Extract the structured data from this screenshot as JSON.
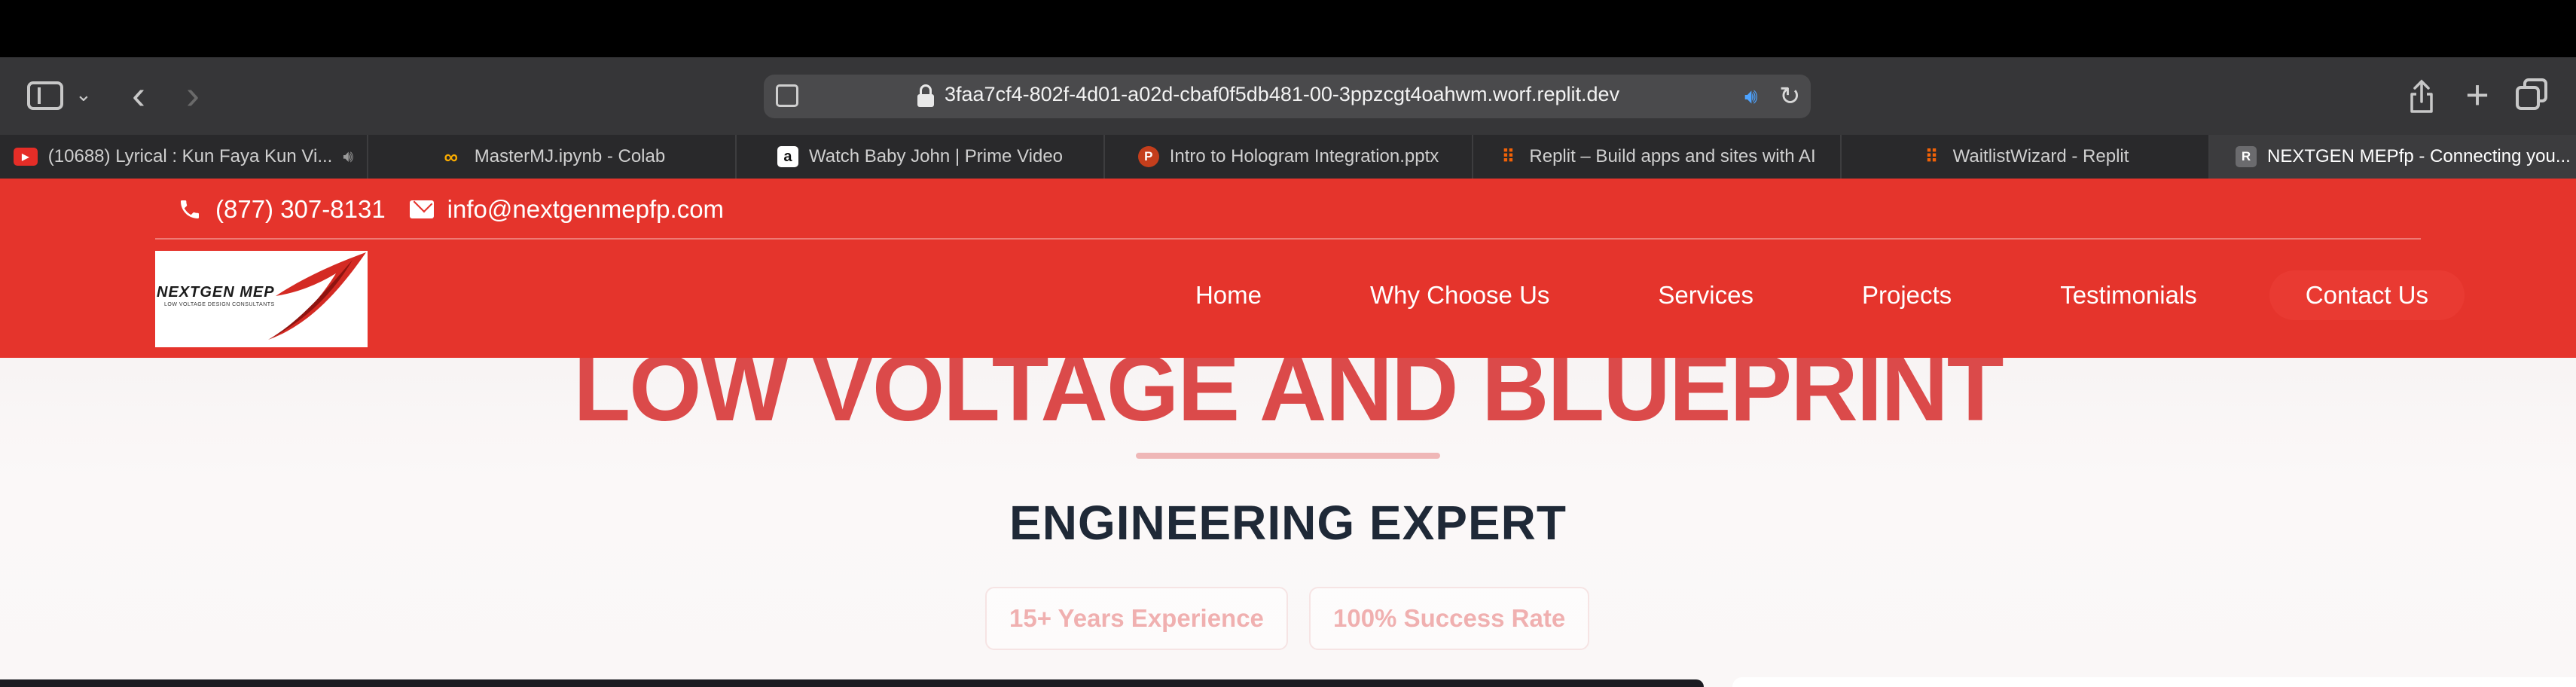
{
  "browser": {
    "url": "3faa7cf4-802f-4d01-a02d-cbaf0f5db481-00-3ppzcgt4oahwm.worf.replit.dev",
    "tabs": [
      {
        "title": "(10688) Lyrical : Kun Faya Kun Vi...",
        "favicon": "youtube-icon",
        "muted_icon": "speaker-icon"
      },
      {
        "title": "MasterMJ.ipynb - Colab",
        "favicon": "colab-icon"
      },
      {
        "title": "Watch Baby John | Prime Video",
        "favicon": "amazon-icon"
      },
      {
        "title": "Intro to Hologram Integration.pptx",
        "favicon": "powerpoint-icon"
      },
      {
        "title": "Replit – Build apps and sites with AI",
        "favicon": "replit-icon"
      },
      {
        "title": "WaitlistWizard - Replit",
        "favicon": "replit-icon"
      },
      {
        "title": "NEXTGEN MEPfp - Connecting you...",
        "favicon": "r-icon",
        "active": true
      }
    ]
  },
  "site": {
    "contact": {
      "phone": "(877) 307-8131",
      "email": "info@nextgenmepfp.com"
    },
    "logo": {
      "text": "NEXTGEN MEP",
      "tagline": "LOW VOLTAGE DESIGN CONSULTANTS"
    },
    "nav": [
      "Home",
      "Why Choose Us",
      "Services",
      "Projects",
      "Testimonials",
      "Contact Us"
    ],
    "hero": {
      "title": "LOW VOLTAGE AND BLUEPRINT",
      "subtitle": "ENGINEERING EXPERT",
      "badges": [
        "15+ Years Experience",
        "100% Success Rate"
      ]
    },
    "colors": {
      "brand_red": "#e5342c",
      "hero_red": "#db4a4a",
      "dark_text": "#1f2937"
    }
  }
}
